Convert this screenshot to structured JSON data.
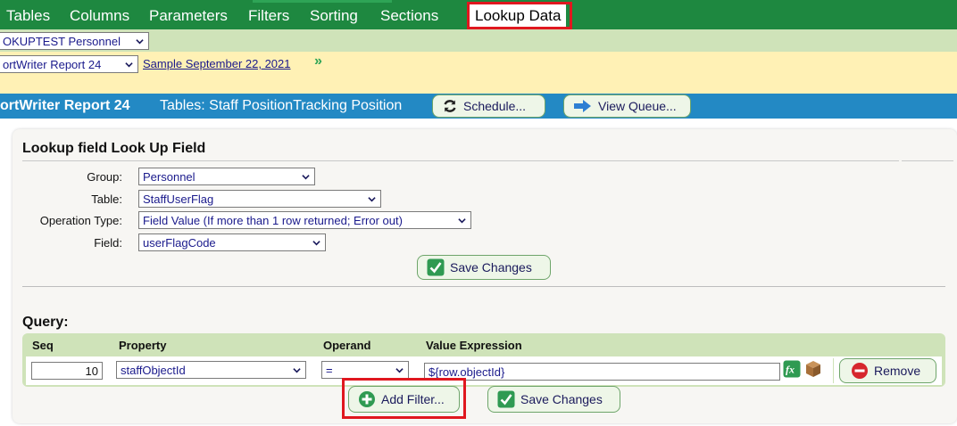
{
  "nav": {
    "tabs": [
      "Tables",
      "Columns",
      "Parameters",
      "Filters",
      "Sorting",
      "Sections"
    ],
    "active_tab": "Lookup Data"
  },
  "context": {
    "group_select": "OKUPTEST Personnel",
    "report_select": "ortWriter Report 24",
    "report_link": "Sample September 22, 2021",
    "next_icon": "double-chevron-right-icon"
  },
  "header": {
    "title": "ortWriter Report 24",
    "tables": "Tables: Staff PositionTracking Position",
    "schedule_button": "Schedule...",
    "view_queue_button": "View Queue..."
  },
  "lookup": {
    "title": "Lookup field Look Up Field",
    "fields": {
      "group_label": "Group:",
      "group_value": "Personnel",
      "table_label": "Table:",
      "table_value": "StaffUserFlag",
      "operation_label": "Operation Type:",
      "operation_value": "Field Value (If more than 1 row returned; Error out)",
      "field_label": "Field:",
      "field_value": "userFlagCode"
    },
    "save_button": "Save Changes"
  },
  "query": {
    "label": "Query:",
    "columns": [
      "Seq",
      "Property",
      "Operand",
      "Value Expression"
    ],
    "rows": [
      {
        "seq": "10",
        "property": "staffObjectId",
        "operand": "=",
        "value_expression": "${row.objectId}",
        "remove_label": "Remove"
      }
    ],
    "add_filter_button": "Add Filter...",
    "save_button": "Save Changes"
  },
  "colors": {
    "nav_green": "#1e8840",
    "context_green": "#cfe3b9",
    "context_yellow": "#fff1b5",
    "header_blue": "#2389c4",
    "highlight_red": "#e0171f"
  }
}
